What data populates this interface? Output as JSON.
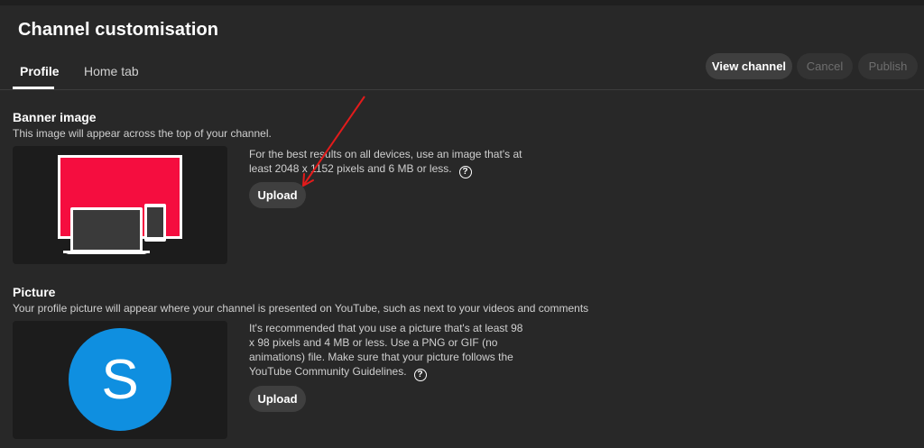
{
  "page": {
    "title": "Channel customisation"
  },
  "tabs": [
    {
      "label": "Profile",
      "active": true
    },
    {
      "label": "Home tab",
      "active": false
    }
  ],
  "actions": {
    "view_channel": "View channel",
    "cancel": "Cancel",
    "publish": "Publish"
  },
  "banner": {
    "title": "Banner image",
    "description": "This image will appear across the top of your channel.",
    "info_line1": "For the best results on all devices, use an image that's at",
    "info_line2": "least 2048 x 1152 pixels and 6 MB or less.",
    "upload_label": "Upload"
  },
  "picture": {
    "title": "Picture",
    "description": "Your profile picture will appear where your channel is presented on YouTube, such as next to your videos and comments",
    "info_line1": "It's recommended that you use a picture that's at least 98",
    "info_line2": "x 98 pixels and 4 MB or less. Use a PNG or GIF (no",
    "info_line3": "animations) file. Make sure that your picture follows the",
    "info_line4": "YouTube Community Guidelines.",
    "avatar_letter": "S",
    "upload_label": "Upload"
  },
  "icons": {
    "help": "?"
  },
  "colors": {
    "background": "#282828",
    "banner_red": "#f50d3f",
    "avatar_blue": "#0f8fe0",
    "annotation_arrow": "#e31b1b"
  }
}
